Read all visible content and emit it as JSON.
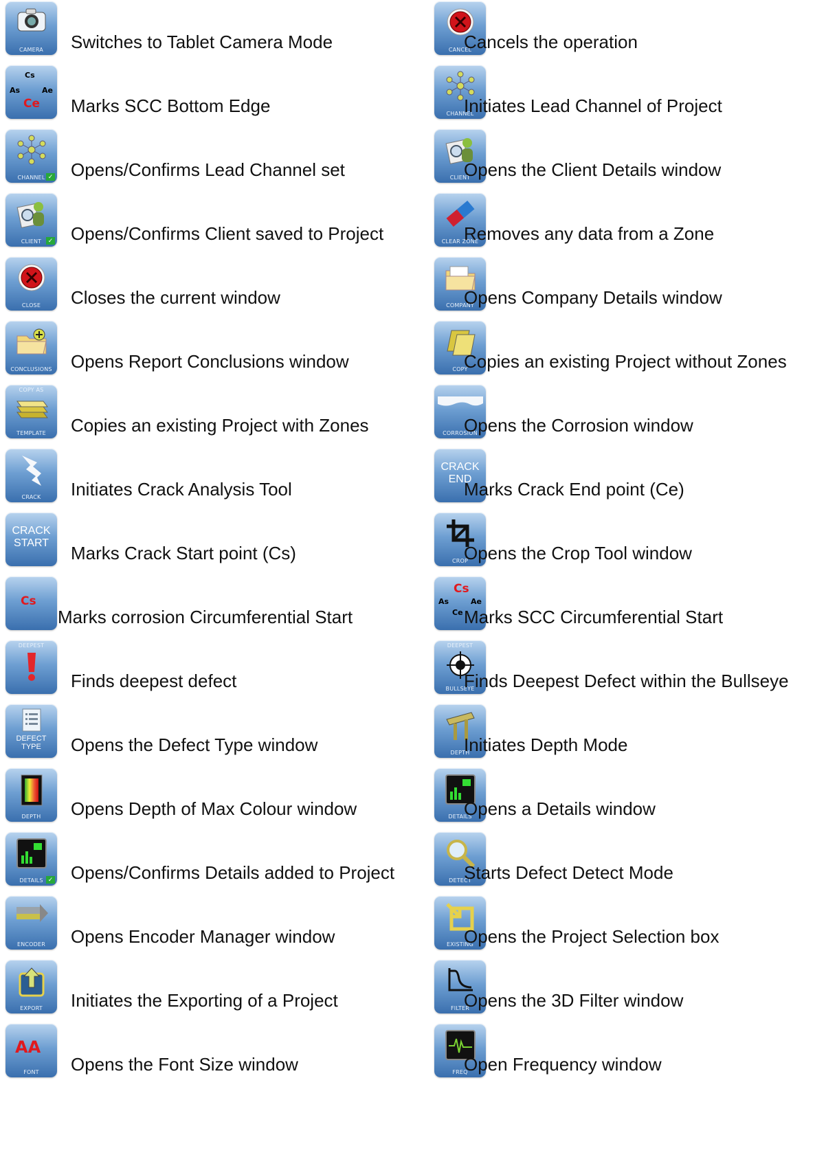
{
  "left_column": [
    {
      "icon_caption": "CAMERA",
      "icon_name": "camera-icon",
      "label": "Switches to Tablet Camera Mode"
    },
    {
      "icon_caption": "",
      "icon_name": "scc-bottom-edge-icon",
      "label": "Marks SCC Bottom Edge",
      "icon_text": {
        "top": "Cs",
        "left": "As",
        "right": "Ae",
        "bottom": "Ce"
      }
    },
    {
      "icon_caption": "CHANNEL",
      "icon_name": "channel-confirmed-icon",
      "label": "Opens/Confirms Lead Channel set",
      "check": true
    },
    {
      "icon_caption": "CLIENT",
      "icon_name": "client-confirmed-icon",
      "label": "Opens/Confirms Client saved to Project",
      "check": true
    },
    {
      "icon_caption": "CLOSE",
      "icon_name": "close-icon",
      "label": "Closes the current window"
    },
    {
      "icon_caption": "CONCLUSIONS",
      "icon_name": "conclusions-icon",
      "label": "Opens Report Conclusions window"
    },
    {
      "icon_caption": "TEMPLATE",
      "icon_top": "COPY AS",
      "icon_name": "copy-as-template-icon",
      "label": "Copies an existing Project with Zones"
    },
    {
      "icon_caption": "CRACK",
      "icon_name": "crack-icon",
      "label": "Initiates Crack Analysis Tool"
    },
    {
      "icon_caption": "",
      "icon_big": "CRACK START",
      "icon_name": "crack-start-icon",
      "label": "Marks Crack Start point (Cs)"
    },
    {
      "icon_caption": "",
      "icon_name": "corrosion-circumferential-start-icon",
      "label": "Marks corrosion Circumferential Start",
      "icon_text": {
        "center": "Cs"
      }
    },
    {
      "icon_caption": "",
      "icon_top": "DEEPEST",
      "icon_name": "deepest-icon",
      "label": "Finds deepest defect"
    },
    {
      "icon_caption": "",
      "icon_name": "defect-type-icon",
      "label": "Opens the Defect Type window",
      "icon_big": "DEFECT TYPE"
    },
    {
      "icon_caption": "DEPTH",
      "icon_name": "depth-colour-icon",
      "label": "Opens Depth of Max Colour window"
    },
    {
      "icon_caption": "DETAILS",
      "icon_name": "details-confirmed-icon",
      "label": "Opens/Confirms Details added to Project",
      "check": true
    },
    {
      "icon_caption": "ENCODER",
      "icon_name": "encoder-icon",
      "label": "Opens Encoder Manager window"
    },
    {
      "icon_caption": "EXPORT",
      "icon_name": "export-icon",
      "label": "Initiates the Exporting of a Project"
    },
    {
      "icon_caption": "FONT",
      "icon_name": "font-icon",
      "label": "Opens the Font Size window",
      "icon_text": {
        "center": "AA"
      }
    }
  ],
  "right_column": [
    {
      "icon_caption": "CANCEL",
      "icon_name": "cancel-icon",
      "label": "Cancels the operation"
    },
    {
      "icon_caption": "CHANNEL",
      "icon_name": "channel-icon",
      "label": "Initiates Lead Channel of Project"
    },
    {
      "icon_caption": "CLIENT",
      "icon_name": "client-icon",
      "label": "Opens the Client Details window"
    },
    {
      "icon_caption": "CLEAR ZONE",
      "icon_name": "clear-zone-icon",
      "label": "Removes any data from a Zone"
    },
    {
      "icon_caption": "COMPANY",
      "icon_name": "company-icon",
      "label": "Opens Company Details window"
    },
    {
      "icon_caption": "COPY",
      "icon_name": "copy-icon",
      "label": "Copies an existing Project without Zones"
    },
    {
      "icon_caption": "CORROSION",
      "icon_name": "corrosion-icon",
      "label": "Opens the Corrosion window"
    },
    {
      "icon_caption": "",
      "icon_big": "CRACK END",
      "icon_name": "crack-end-icon",
      "label": "Marks Crack End point (Ce)"
    },
    {
      "icon_caption": "CROP",
      "icon_name": "crop-icon",
      "label": "Opens the Crop Tool window"
    },
    {
      "icon_caption": "",
      "icon_name": "scc-circumferential-start-icon",
      "label": "Marks SCC Circumferential Start",
      "icon_text": {
        "top": "Cs",
        "left": "As",
        "right": "Ae",
        "bottom": "Ce"
      }
    },
    {
      "icon_caption": "BULLSEYE",
      "icon_top": "DEEPEST",
      "icon_name": "bullseye-icon",
      "label": "Finds Deepest Defect within the Bullseye"
    },
    {
      "icon_caption": "DEPTH",
      "icon_name": "depth-icon",
      "label": "Initiates Depth Mode"
    },
    {
      "icon_caption": "DETAILS",
      "icon_name": "details-icon",
      "label": "Opens a Details window"
    },
    {
      "icon_caption": "DETECT",
      "icon_name": "detect-icon",
      "label": "Starts Defect Detect Mode"
    },
    {
      "icon_caption": "EXISTING",
      "icon_name": "existing-icon",
      "label": "Opens the Project Selection box"
    },
    {
      "icon_caption": "FILTER",
      "icon_name": "filter-icon",
      "label": "Opens the 3D Filter window"
    },
    {
      "icon_caption": "FREQ",
      "icon_name": "freq-icon",
      "label": "Open Frequency window"
    }
  ],
  "colors": {
    "icon_top": "#b8d3ee",
    "icon_bottom": "#3a6fae",
    "text": "#111111",
    "accent_red": "#e0191e",
    "check_green": "#27a83a"
  }
}
